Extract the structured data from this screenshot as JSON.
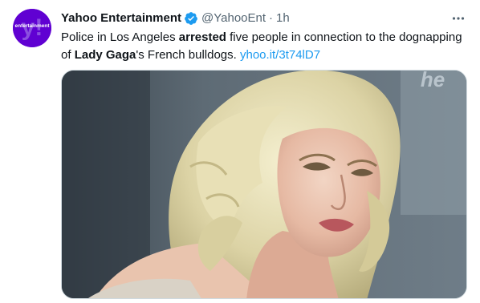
{
  "author": {
    "display_name": "Yahoo Entertainment",
    "handle": "@YahooEnt",
    "separator": "·",
    "time": "1h",
    "avatar_text": "entertainment",
    "avatar_mark": "y!"
  },
  "tweet": {
    "text_1": "Police in Los Angeles ",
    "text_bold_1": "arrested",
    "text_2": " five people in connection to the dognapping of ",
    "text_bold_2": "Lady Gaga",
    "text_3": "'s French bulldogs. ",
    "link": "yhoo.it/3t74lD7"
  },
  "media": {
    "backdrop_text": "he",
    "alt": "photo of a woman with platinum blonde wavy hair"
  },
  "icons": {
    "verified": "verified-badge-icon",
    "more": "more-dots-icon"
  },
  "colors": {
    "brand_purple": "#6001d2",
    "link_blue": "#1d9bf0",
    "secondary_text": "#536471"
  }
}
